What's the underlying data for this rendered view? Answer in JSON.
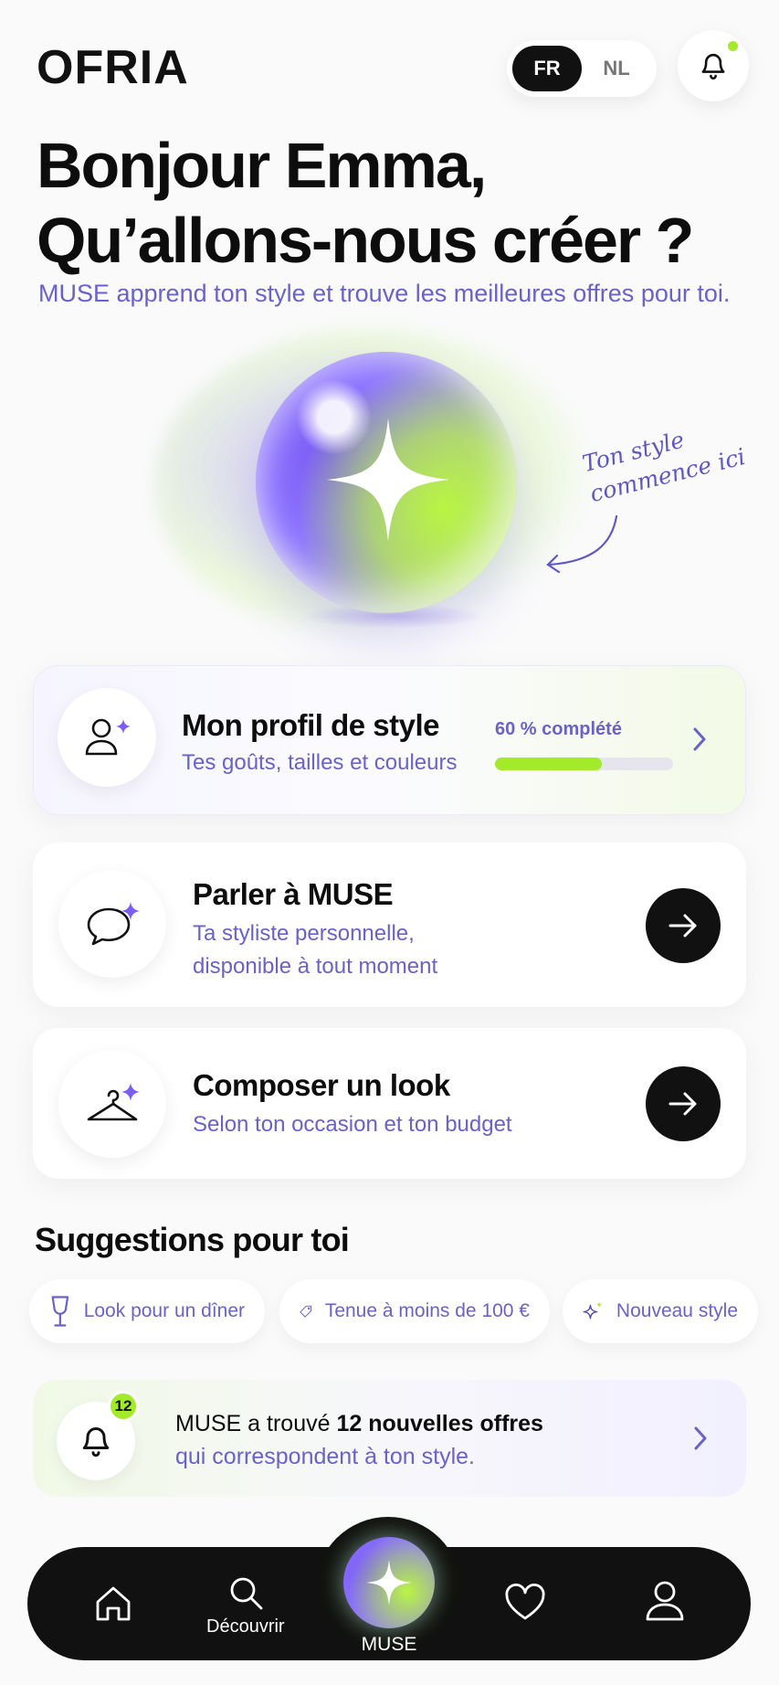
{
  "header": {
    "logo_text": "OFRIA",
    "lang": {
      "active": "FR",
      "inactive": "NL"
    },
    "notification_dot_color": "#a3ea2a"
  },
  "greeting": {
    "line1": "Bonjour Emma,",
    "line2": "Qu’allons-nous créer ?",
    "subtitle": "MUSE apprend ton style et trouve les meilleures offres pour toi."
  },
  "hero": {
    "handwritten_line1": "Ton style",
    "handwritten_line2": "commence ici"
  },
  "cards": {
    "profile": {
      "title": "Mon profil de style",
      "subtitle": "Tes goûts, tailles et couleurs",
      "progress_label": "60 % complété",
      "progress_value": 0.6
    },
    "talk": {
      "title": "Parler à MUSE",
      "subtitle_line1": "Ta styliste personnelle,",
      "subtitle_line2": "disponible à tout moment"
    },
    "look": {
      "title": "Composer un look",
      "subtitle": "Selon ton occasion et ton budget"
    }
  },
  "suggestions": {
    "title": "Suggestions pour toi",
    "chips": [
      {
        "label": "Look pour un dîner",
        "icon": "wine-glass-icon"
      },
      {
        "label": "Tenue à moins de 100 €",
        "icon": "price-tag-icon"
      },
      {
        "label": "Nouveau style",
        "icon": "sparkles-icon"
      }
    ]
  },
  "offers": {
    "badge_count": "12",
    "text_prefix": "MUSE a trouvé ",
    "text_bold": "12 nouvelles offres",
    "text_line2": "qui correspondent à ton style."
  },
  "nav": {
    "items": [
      {
        "label": "",
        "icon": "home-icon"
      },
      {
        "label": "Découvrir",
        "icon": "search-icon"
      },
      {
        "label": "MUSE",
        "icon": "sparkle-icon"
      },
      {
        "label": "",
        "icon": "heart-icon"
      },
      {
        "label": "",
        "icon": "user-icon"
      }
    ]
  },
  "colors": {
    "accent_purple": "#6a62c9",
    "accent_green": "#a3ea2a",
    "dark": "#111111"
  }
}
